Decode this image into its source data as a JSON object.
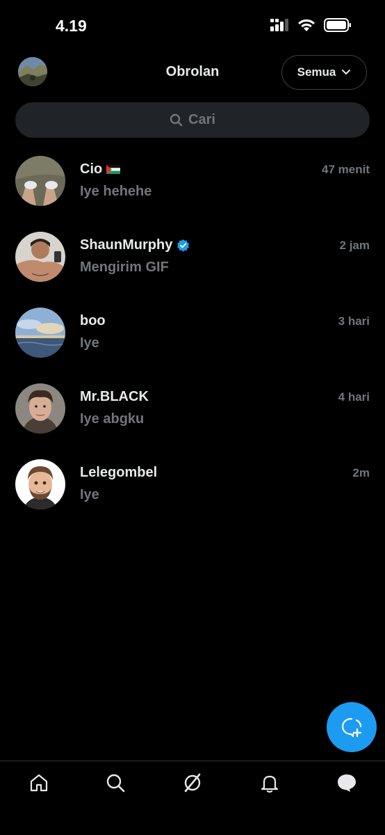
{
  "status_bar": {
    "time": "4.19",
    "icons": [
      "cellular-signal-icon",
      "wifi-icon",
      "battery-icon"
    ]
  },
  "header": {
    "title": "Obrolan",
    "filter_label": "Semua",
    "avatar_icon": "profile-avatar"
  },
  "search": {
    "placeholder": "Cari",
    "icon": "search-icon"
  },
  "conversations": [
    {
      "name": "Cio",
      "badge": "palestine-flag-icon",
      "time": "47 menit",
      "preview": "Iye hehehe"
    },
    {
      "name": "ShaunMurphy",
      "badge": "verified-badge-icon",
      "time": "2 jam",
      "preview": "Mengirim GIF"
    },
    {
      "name": "boo",
      "badge": "",
      "time": "3 hari",
      "preview": "Iye"
    },
    {
      "name": "Mr.BLACK",
      "badge": "",
      "time": "4 hari",
      "preview": "Iye abgku"
    },
    {
      "name": "Lelegombel",
      "badge": "",
      "time": "2m",
      "preview": "Iye"
    }
  ],
  "fab": {
    "icon": "new-message-icon"
  },
  "bottom_nav": {
    "items": [
      "home-icon",
      "search-icon",
      "grok-icon",
      "notifications-icon",
      "messages-icon"
    ],
    "active": "messages-icon"
  },
  "colors": {
    "background": "#000000",
    "primary_text": "#e7e9ea",
    "secondary_text": "#71767b",
    "accent": "#1d9bf0",
    "search_bg": "#202327",
    "divider": "#2f3336"
  }
}
